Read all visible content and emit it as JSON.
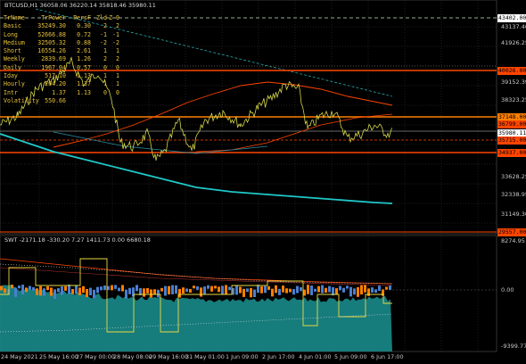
{
  "window": {
    "title": "BTCUSD,H1 36058.06 36220.14 35818.46 35980.11",
    "subtitle": "SWT -2171.18 -330.20 7.27 1411.73 0.00 6680.18"
  },
  "table": {
    "header": [
      "TrName",
      "TrPower",
      "PersF",
      "Zld",
      "Z-0"
    ],
    "rows": [
      [
        "Basic",
        "35249.30",
        "0.30",
        "2",
        "2"
      ],
      [
        "Long",
        "52666.88",
        "0.72",
        "-1",
        "-1"
      ],
      [
        "Medium",
        "32505.32",
        "0.88",
        "-2",
        "-2"
      ],
      [
        "Short",
        "16554.26",
        "2.61",
        "1",
        "1"
      ],
      [
        "Weekly",
        "2839.69",
        "1.26",
        "2",
        "2"
      ],
      [
        "Daily",
        "1967.04",
        "0.57",
        "0",
        "0"
      ],
      [
        "Iday",
        "517.10",
        "1.13",
        "1",
        "1"
      ],
      [
        "Hourly",
        "204.20",
        "1.37",
        "1",
        "1"
      ],
      [
        "Intr",
        "1.37",
        "1.13",
        "0",
        "0"
      ],
      [
        "Volatility",
        "550.66",
        "",
        "",
        ""
      ]
    ]
  },
  "price_axis": {
    "labels": [
      "43402.00",
      "43137.40",
      "41926.25",
      "40026.00",
      "39152.39",
      "38323.25",
      "37148.00",
      "36799.00",
      "35980.11",
      "35715.00",
      "34937.00",
      "33628.25",
      "32338.95",
      "31149.36",
      "29557.00"
    ]
  },
  "level_labels": {
    "top_dash": {
      "text": "43402.00",
      "color": "#ffffff"
    },
    "red_1": {
      "text": "40026.00",
      "color": "#ff4500"
    },
    "orange_1": {
      "text": "37148.00",
      "color": "#ff7f00"
    },
    "teal_1": {
      "text": "36799.00",
      "color": "#40e0d0"
    },
    "current": {
      "text": "35980.11",
      "color": "#ffffff"
    },
    "red_2": {
      "text": "35715.00",
      "color": "#ff4500"
    },
    "red_3": {
      "text": "34937.00",
      "color": "#ff4500"
    },
    "bottom_red": {
      "text": "29557.00",
      "color": "#ff4500"
    }
  },
  "osc_axis": {
    "labels": [
      "8274.95",
      "0.00",
      "-9399.77"
    ]
  },
  "time_axis": {
    "labels": [
      "24 May 2021",
      "25 May 16:00",
      "27 May 00:00",
      "28 May 08:00",
      "29 May 16:00",
      "31 May 01:00",
      "1 Jun 09:00",
      "2 Jun 17:00",
      "4 Jun 01:00",
      "5 Jun 09:00",
      "6 Jun 17:00"
    ]
  },
  "colors": {
    "price": "#d4d44a",
    "teal": "#20c8c8",
    "red": "#ff4500",
    "grid": "#3c3c3c",
    "background": "#000000"
  }
}
